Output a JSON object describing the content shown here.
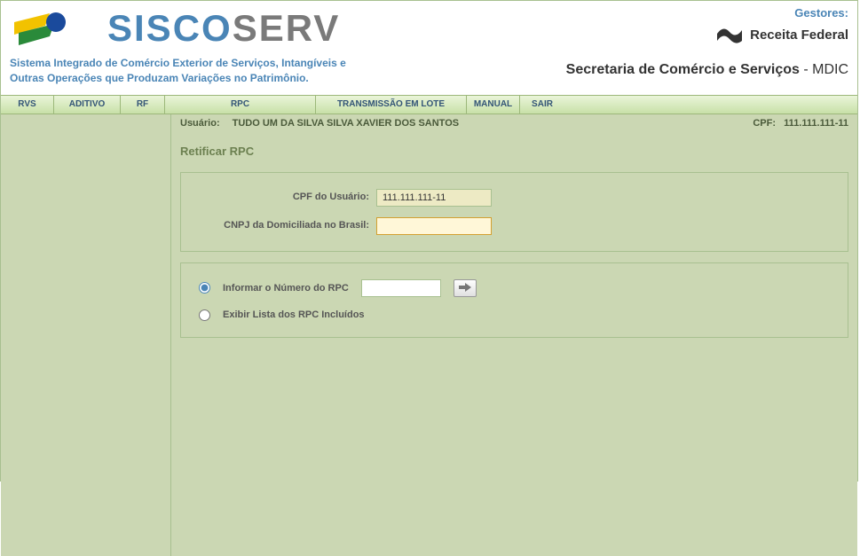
{
  "header": {
    "logo_prefix": "SISCO",
    "logo_suffix": "SERV",
    "subtitle_line1": "Sistema Integrado de Comércio Exterior de Serviços, Intangíveis e",
    "subtitle_line2": "Outras Operações que Produzam Variações no Patrimônio.",
    "gestores": "Gestores:",
    "receita": "Receita Federal",
    "secretaria": "Secretaria de Comércio e Serviços",
    "secretaria_suffix": " - MDIC"
  },
  "menu": {
    "rvs": "RVS",
    "aditivo": "ADITIVO",
    "rf": "RF",
    "rpc": "RPC",
    "transmissao": "TRANSMISSÃO EM LOTE",
    "manual": "MANUAL",
    "sair": "SAIR"
  },
  "userbar": {
    "usuario_label": "Usuário:",
    "usuario_value": "TUDO UM DA SILVA SILVA XAVIER DOS SANTOS",
    "cpf_label": "CPF:",
    "cpf_value": "111.111.111-11"
  },
  "page": {
    "title": "Retificar RPC",
    "cpf_usuario_label": "CPF do Usuário:",
    "cpf_usuario_value": "111.111.111-11",
    "cnpj_label": "CNPJ da Domiciliada no Brasil:",
    "cnpj_value": "",
    "opt1_label": "Informar o Número do RPC",
    "opt1_value": "",
    "opt2_label": "Exibir Lista dos RPC Incluídos"
  }
}
